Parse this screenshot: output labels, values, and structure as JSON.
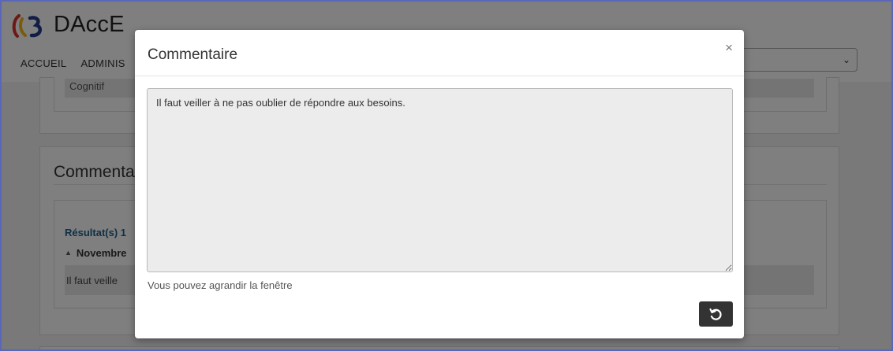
{
  "app": {
    "brand": "DAccE",
    "nav": [
      "ACCUEIL",
      "ADMINIS"
    ],
    "background": {
      "card1_text": "Cognitif",
      "card2_title": "Commenta",
      "results_label": "Résultat(s) 1",
      "month_label": "Novembre",
      "comment_preview": "Il faut veille"
    }
  },
  "modal": {
    "title": "Commentaire",
    "close_label": "×",
    "textarea_value": "Il faut veiller à ne pas oublier de répondre aux besoins.",
    "hint": "Vous pouvez agrandir la fenêtre",
    "button_icon": "undo-icon"
  },
  "colors": {
    "frame_border": "#5a67b8",
    "results_link": "#1f5f8b",
    "button_dark": "#333333",
    "overlay": "rgba(0,0,0,0.5)"
  }
}
